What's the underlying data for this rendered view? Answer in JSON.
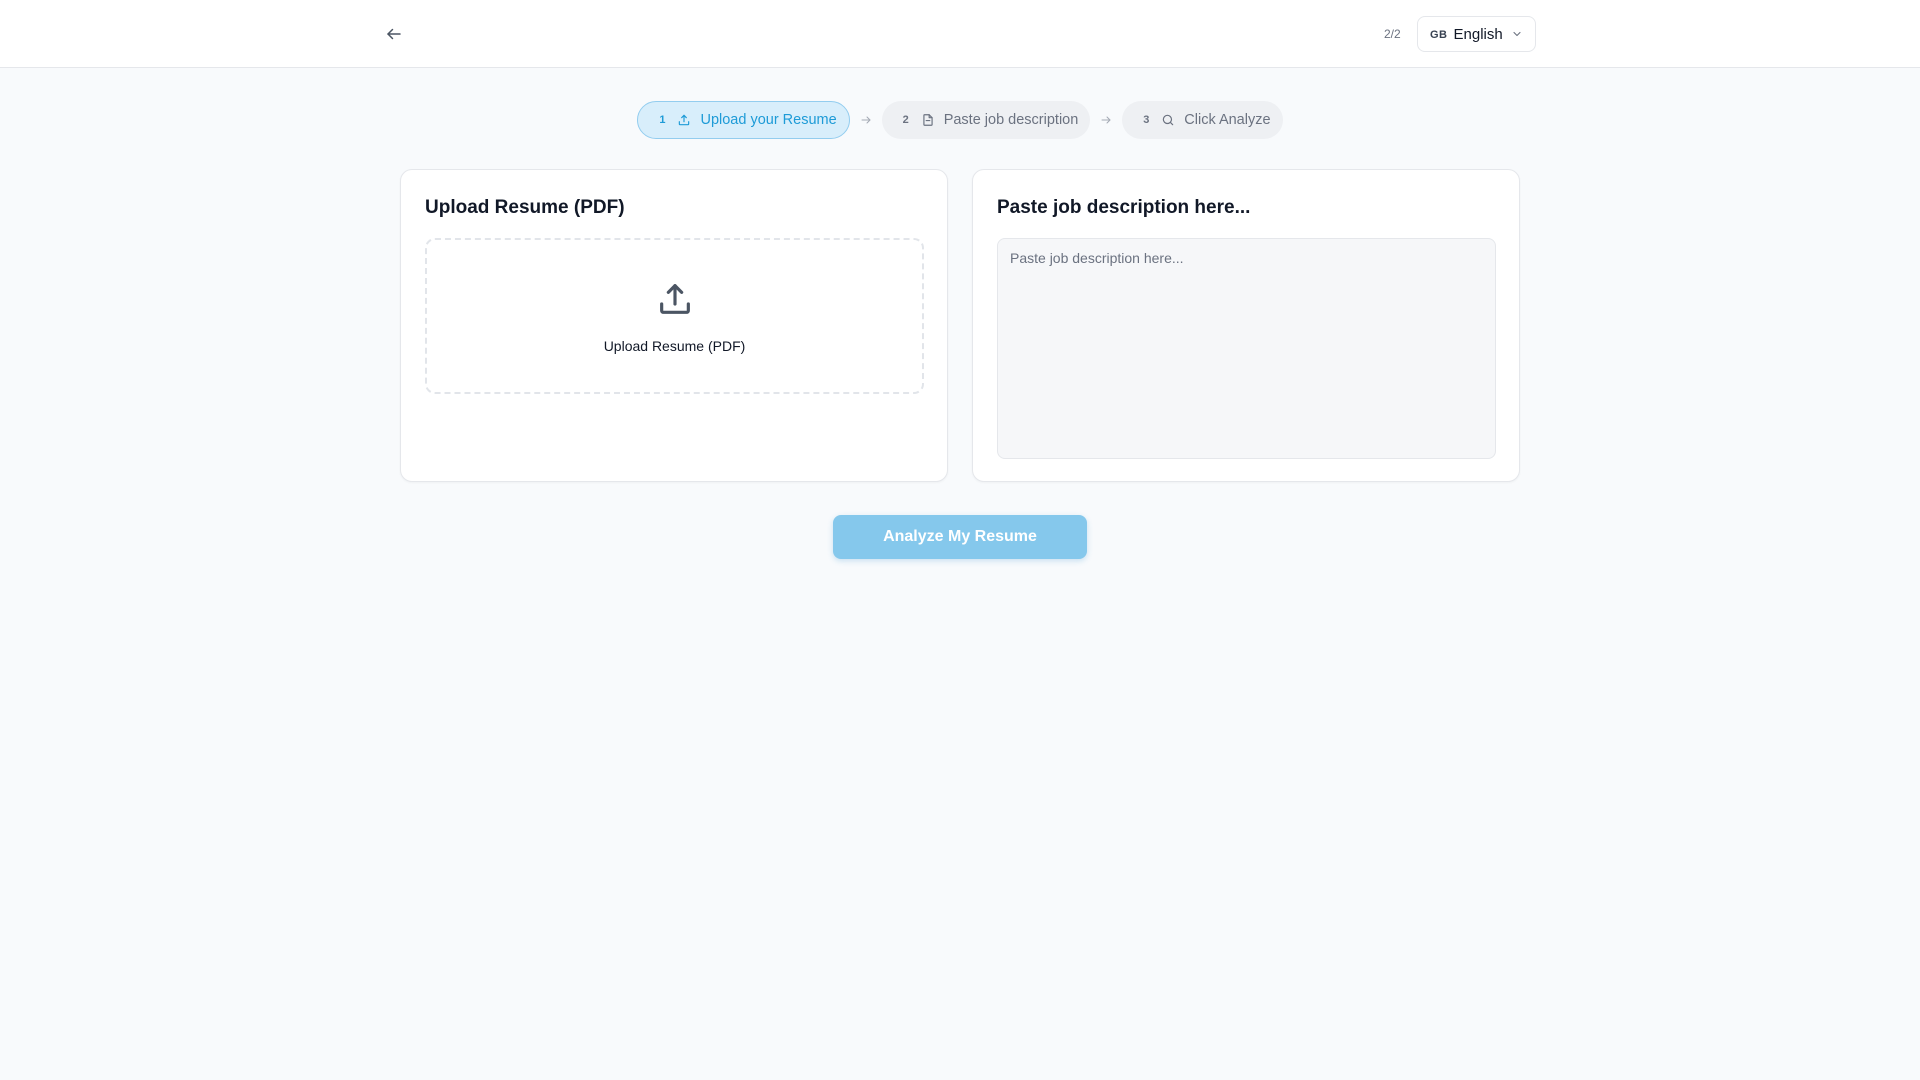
{
  "header": {
    "back_icon": "arrow-left-icon",
    "page_count": "2/2",
    "language": {
      "flag": "GB",
      "label": "English",
      "icon": "chevron-down-icon"
    }
  },
  "steps": [
    {
      "number": "1",
      "label": "Upload your Resume",
      "icon": "upload-icon",
      "active": true
    },
    {
      "number": "2",
      "label": "Paste job description",
      "icon": "document-icon",
      "active": false
    },
    {
      "number": "3",
      "label": "Click Analyze",
      "icon": "search-icon",
      "active": false
    }
  ],
  "upload_card": {
    "title": "Upload Resume (PDF)",
    "dropzone_label": "Upload Resume (PDF)",
    "icon": "upload-icon"
  },
  "job_card": {
    "title": "Paste job description here...",
    "textarea_value": "",
    "textarea_placeholder": "Paste job description here..."
  },
  "analyze_button": {
    "label": "Analyze My Resume",
    "enabled": false
  },
  "colors": {
    "accent": "#1e9bd7",
    "accent_light": "#d8eefb",
    "button_disabled": "#85c8ec",
    "background": "#f8fafc"
  }
}
